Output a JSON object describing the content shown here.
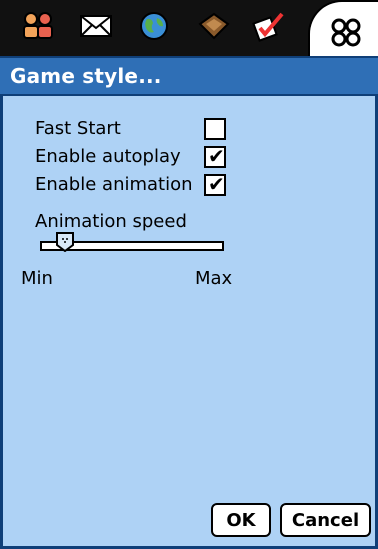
{
  "tabs": [
    {
      "icon": "people-icon"
    },
    {
      "icon": "mail-icon"
    },
    {
      "icon": "globe-icon"
    },
    {
      "icon": "wallet-icon"
    },
    {
      "icon": "checklist-icon"
    },
    {
      "icon": "apps-icon",
      "active": true
    }
  ],
  "title": "Game style...",
  "options": {
    "fast_start": {
      "label": "Fast Start",
      "checked": false
    },
    "enable_autoplay": {
      "label": "Enable autoplay",
      "checked": true
    },
    "enable_animation": {
      "label": "Enable animation",
      "checked": true
    }
  },
  "animation_speed": {
    "label": "Animation speed",
    "min_label": "Min",
    "max_label": "Max",
    "value": 0.1
  },
  "buttons": {
    "ok": "OK",
    "cancel": "Cancel"
  },
  "check_glyph": "✔",
  "colors": {
    "titlebar": "#2f6fb6",
    "panel": "#aed2f5",
    "border": "#0f3f78"
  }
}
